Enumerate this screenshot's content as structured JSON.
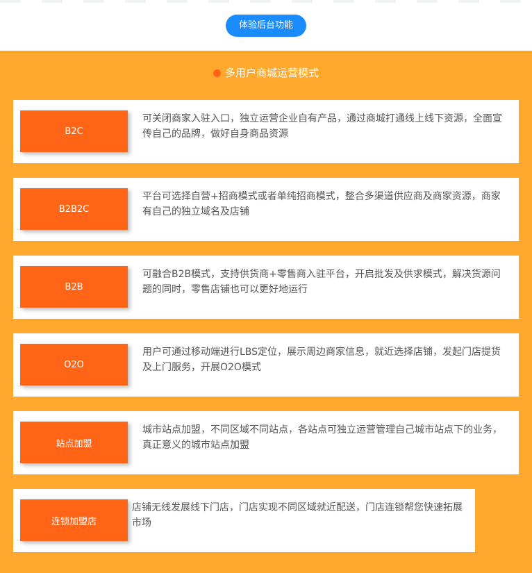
{
  "header": {
    "cta_label": "体验后台功能"
  },
  "section": {
    "title": "多用户商城运营模式"
  },
  "modes": [
    {
      "name": "B2C",
      "description": "可关闭商家入驻入口，独立运营企业自有产品，通过商城打通线上线下资源，全面宣传自己的品牌，做好自身商品资源"
    },
    {
      "name": "B2B2C",
      "description": "平台可选择自营+招商模式或者单纯招商模式，整合多渠道供应商及商家资源，商家有自己的独立域名及店铺"
    },
    {
      "name": "B2B",
      "description": "可融合B2B模式，支持供货商+零售商入驻平台，开启批发及供求模式，解决货源问题的同时，零售店铺也可以更好地运行"
    },
    {
      "name": "O2O",
      "description": "用户可通过移动端进行LBS定位，展示周边商家信息，就近选择店铺，发起门店提货及上门服务，开展O2O模式"
    },
    {
      "name": "站点加盟",
      "description": "城市站点加盟，不同区域不同站点，各站点可独立运营管理自己城市站点下的业务，真正意义的城市站点加盟"
    },
    {
      "name": "连锁加盟店",
      "description": "店铺无线发展线下门店，门店实现不同区域就近配送，门店连锁帮您快速拓展市场"
    }
  ],
  "colors": {
    "accent_blue": "#1a8cff",
    "panel_orange": "#ffa82b",
    "badge_orange": "#ff6417",
    "text_gray": "#555555"
  }
}
